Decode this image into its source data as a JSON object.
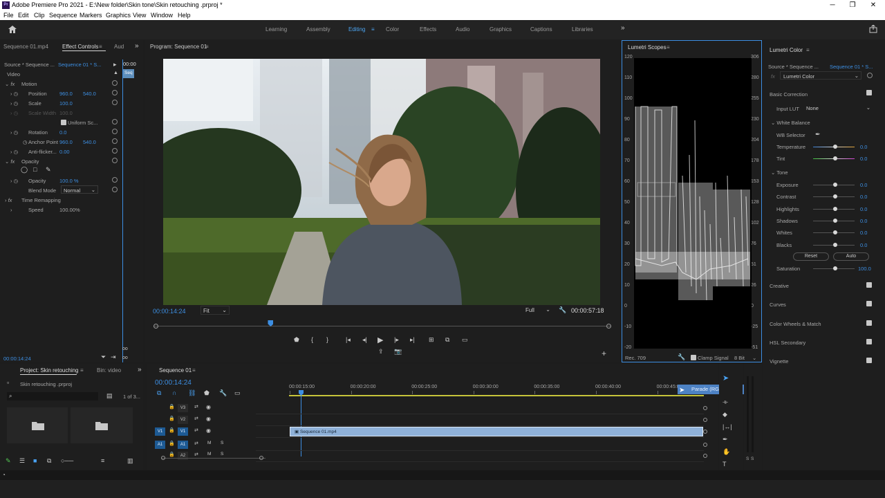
{
  "window": {
    "title": "Adobe Premiere Pro 2021 - E:\\New folder\\Skin tone\\Skin retouching .prproj *",
    "app_badge": "Pr"
  },
  "menu": [
    "File",
    "Edit",
    "Clip",
    "Sequence",
    "Markers",
    "Graphics",
    "View",
    "Window",
    "Help"
  ],
  "workspaces": [
    "Learning",
    "Assembly",
    "Editing",
    "Color",
    "Effects",
    "Audio",
    "Graphics",
    "Captions",
    "Libraries"
  ],
  "workspace_more": "»",
  "effect_controls": {
    "tabs": [
      "Sequence 01.mp4",
      "Effect Controls",
      "Aud"
    ],
    "source": "Source * Sequence ...",
    "sequence": "Sequence 01 * S...",
    "mini_time": "00:00",
    "mini_clip": "Seq",
    "video_label": "Video",
    "motion": "Motion",
    "position_label": "Position",
    "position_x": "960.0",
    "position_y": "540.0",
    "scale_label": "Scale",
    "scale_value": "100.0",
    "scale_width_label": "Scale Width",
    "scale_width_value": "100.0",
    "uniform_label": "Uniform Sc...",
    "rotation_label": "Rotation",
    "rotation_value": "0.0",
    "anchor_label": "Anchor Point",
    "anchor_x": "960.0",
    "anchor_y": "540.0",
    "antiflicker_label": "Anti-flicker...",
    "antiflicker_value": "0.00",
    "opacity_section": "Opacity",
    "opacity_label": "Opacity",
    "opacity_value": "100.0 %",
    "blend_label": "Blend Mode",
    "blend_value": "Normal",
    "time_remap": "Time Remapping",
    "speed_label": "Speed",
    "speed_value": "100.00%",
    "timecode": "00:00:14:24"
  },
  "program": {
    "title": "Program: Sequence 01",
    "timecode": "00:00:14:24",
    "fit": "Fit",
    "quality": "Full",
    "duration": "00:00:57:18",
    "playhead_fraction": 0.256
  },
  "scopes": {
    "title": "Lumetri Scopes",
    "left_ticks": [
      "120",
      "110",
      "100",
      "90",
      "80",
      "70",
      "60",
      "50",
      "40",
      "30",
      "20",
      "10",
      "0",
      "-10",
      "-20"
    ],
    "right_ticks": [
      "306",
      "280",
      "255",
      "230",
      "204",
      "178",
      "153",
      "128",
      "102",
      "76",
      "51",
      "26",
      "0",
      "-25",
      "-51"
    ],
    "standard": "Rec. 709",
    "clamp_label": "Clamp Signal",
    "bit_depth": "8 Bit"
  },
  "lumetri": {
    "title": "Lumetri Color",
    "source": "Source * Sequence ...",
    "sequence": "Sequence 01 * S...",
    "effect": "Lumetri Color",
    "basic": "Basic Correction",
    "input_lut_label": "Input LUT",
    "input_lut_value": "None",
    "white_balance": "White Balance",
    "wb_selector": "WB Selector",
    "sliders": [
      {
        "label": "Temperature",
        "value": "0.0"
      },
      {
        "label": "Tint",
        "value": "0.0"
      }
    ],
    "tone": "Tone",
    "tone_sliders": [
      {
        "label": "Exposure",
        "value": "0.0"
      },
      {
        "label": "Contrast",
        "value": "0.0"
      },
      {
        "label": "Highlights",
        "value": "0.0"
      },
      {
        "label": "Shadows",
        "value": "0.0"
      },
      {
        "label": "Whites",
        "value": "0.0"
      },
      {
        "label": "Blacks",
        "value": "0.0"
      }
    ],
    "reset": "Reset",
    "auto": "Auto",
    "saturation_label": "Saturation",
    "saturation_value": "100.0",
    "sections": [
      "Creative",
      "Curves",
      "Color Wheels & Match",
      "HSL Secondary",
      "Vignette"
    ]
  },
  "project": {
    "tabs": [
      "Project: Skin retouching",
      "Bin: video"
    ],
    "file": "Skin retouching .prproj",
    "count": "1 of 3..."
  },
  "timeline": {
    "title": "Sequence 01",
    "timecode": "00:00:14:24",
    "ruler": [
      "00:00:15:00",
      "00:00:20:00",
      "00:00:25:00",
      "00:00:30:00",
      "00:00:35:00",
      "00:00:40:00",
      "00:00:45:00"
    ],
    "tooltip": "Parade (RGB)",
    "clip_name": "Sequence 01.mp4",
    "tracks": [
      "V3",
      "V2",
      "V1",
      "A1",
      "A2"
    ],
    "src_v1": "V1",
    "src_a1": "A1"
  },
  "meter_labels": [
    "S",
    "S"
  ],
  "colors": {
    "accent": "#3d8fe3",
    "clip": "#8fb1d8",
    "panel": "#1e1e1e"
  }
}
